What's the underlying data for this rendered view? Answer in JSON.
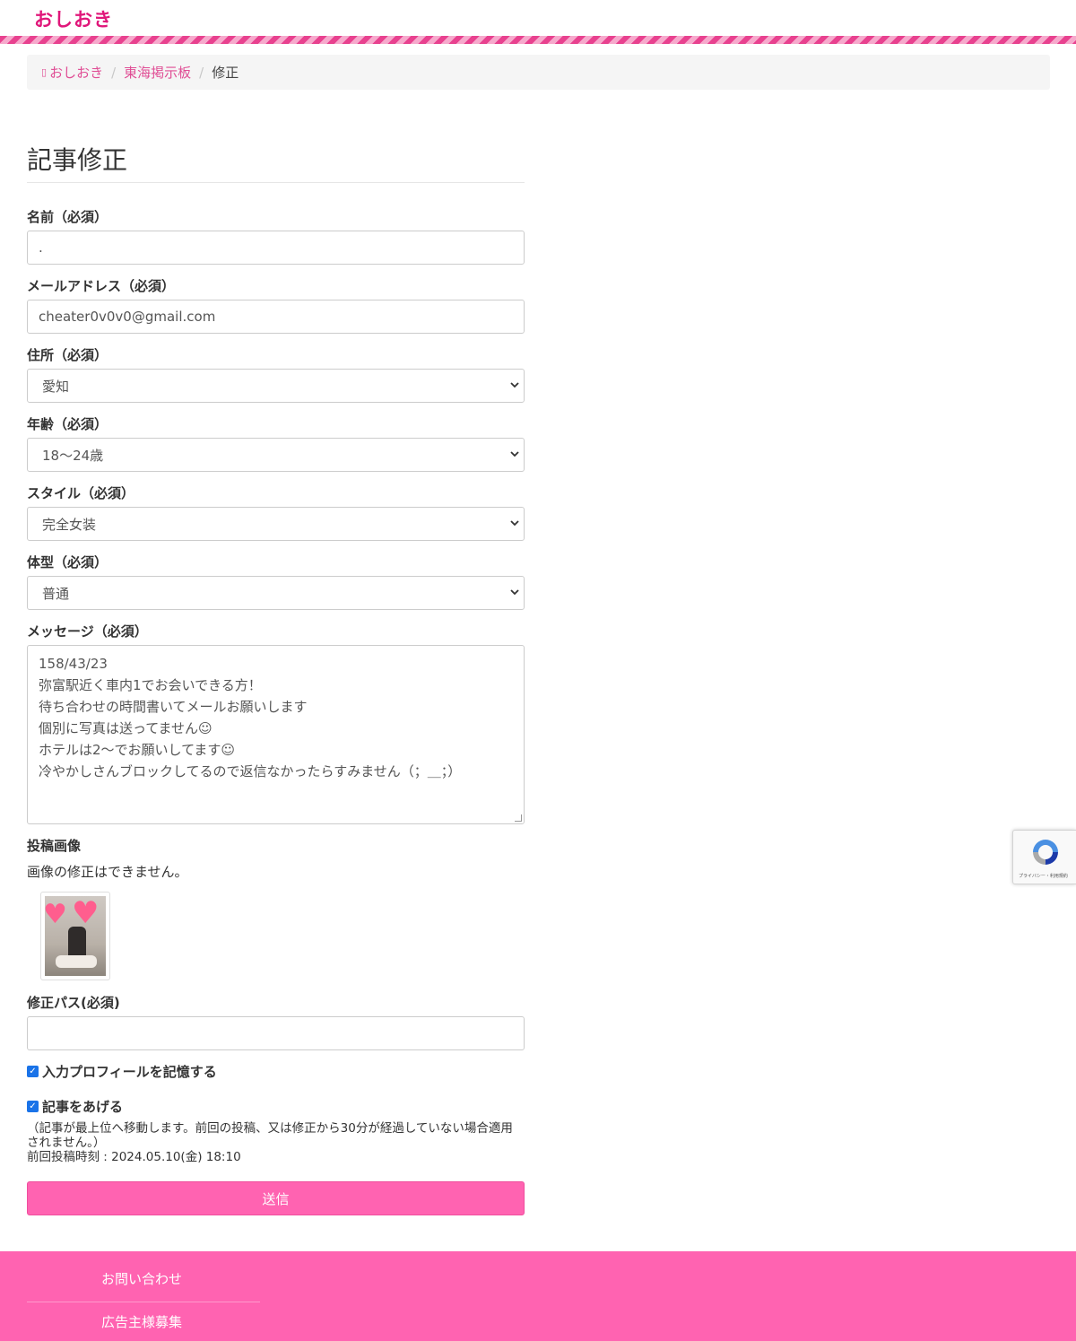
{
  "header": {
    "logo": "おしおき"
  },
  "breadcrumb": {
    "home": "おしおき",
    "board": "東海掲示板",
    "current": "修正"
  },
  "page": {
    "title": "記事修正"
  },
  "form": {
    "name": {
      "label": "名前（必須）",
      "value": "."
    },
    "email": {
      "label": "メールアドレス（必須）",
      "value": "cheater0v0v0@gmail.com"
    },
    "address": {
      "label": "住所（必須）",
      "selected": "愛知"
    },
    "age": {
      "label": "年齢（必須）",
      "selected": "18〜24歳"
    },
    "style": {
      "label": "スタイル（必須）",
      "selected": "完全女装"
    },
    "body": {
      "label": "体型（必須）",
      "selected": "普通"
    },
    "message": {
      "label": "メッセージ（必須）",
      "lines": [
        "158/43/23",
        "弥富駅近く車内1でお会いできる方！",
        "待ち合わせの時間書いてメールお願いします",
        "個別に写真は送ってません☺︎",
        "ホテルは2〜でお願いしてます☺︎",
        "冷やかしさんブロックしてるので返信なかったらすみません（；＿；）"
      ]
    },
    "image": {
      "label": "投稿画像",
      "note": "画像の修正はできません。"
    },
    "edit_pass": {
      "label": "修正パス(必須)",
      "value": ""
    },
    "remember": {
      "label": "入力プロフィールを記憶する",
      "checked": true
    },
    "bump": {
      "label": "記事をあげる",
      "checked": true,
      "note": "（記事が最上位へ移動します。前回の投稿、又は修正から30分が経過していない場合適用されません。）",
      "last_post": "前回投稿時刻 : 2024.05.10(金) 18:10"
    },
    "submit_label": "送信"
  },
  "recaptcha": {
    "text": "プライバシー・利用規約"
  },
  "footer": {
    "links": [
      "お問い合わせ",
      "広告主様募集"
    ]
  },
  "colors": {
    "brand_pink": "#ff63b1",
    "link_pink": "#e04e95",
    "logo_pink": "#e0177a"
  }
}
